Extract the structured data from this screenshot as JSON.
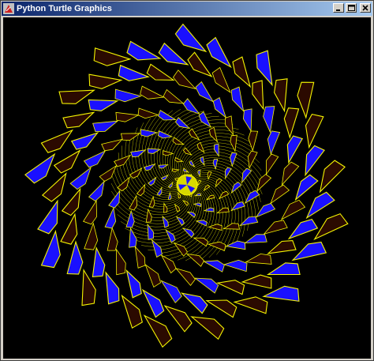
{
  "window": {
    "title": "Python Turtle Graphics",
    "icon": "tk-feather-icon",
    "controls": [
      "minimize-icon",
      "maximize-icon",
      "close-icon"
    ]
  },
  "canvas": {
    "background": "#000000",
    "colors": {
      "outline": "#f4f400",
      "fill_blue": "#1a10ff",
      "fill_dark": "#2b0a00",
      "center": "#d8d800"
    }
  }
}
